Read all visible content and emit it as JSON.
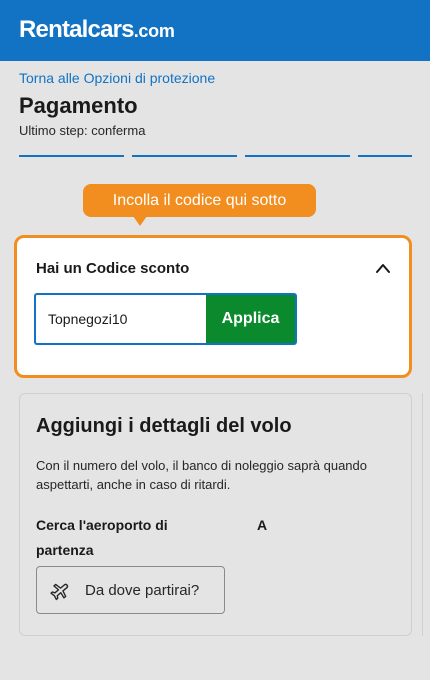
{
  "header": {
    "logo_text": "Rentalcars",
    "logo_suffix": ".com",
    "background_color": "#1273c4"
  },
  "nav": {
    "back_link": "Torna alle Opzioni di protezione"
  },
  "page": {
    "title": "Pagamento",
    "subtitle": "Ultimo step: conferma",
    "progress_steps": 4
  },
  "annotation": {
    "tooltip_text": "Incolla il codice qui sotto",
    "tooltip_color": "#f18e1f"
  },
  "promo": {
    "title": "Hai un Codice sconto",
    "expanded": true,
    "toggle_icon": "chevron-up-icon",
    "input_value": "Topnegozi10",
    "apply_label": "Applica",
    "apply_color": "#0a8a2c"
  },
  "flight": {
    "title": "Aggiungi i dettagli del volo",
    "description": "Con il numero del volo, il banco di noleggio saprà quando aspettarti, anche in caso di ritardi.",
    "airport_label": "Cerca l'aeroporto di partenza",
    "to_label": "A",
    "departure_button_label": "Da dove partirai?",
    "departure_icon": "airplane-icon"
  }
}
